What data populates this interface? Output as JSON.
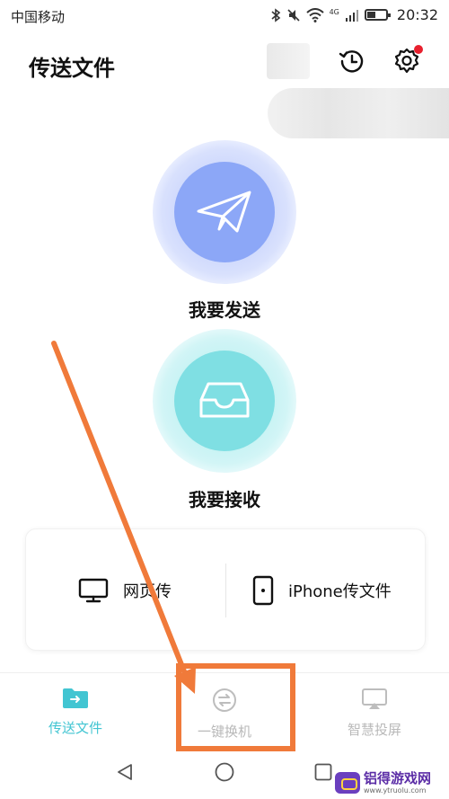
{
  "status_bar": {
    "carrier": "中国移动",
    "network": "4G",
    "time": "20:32",
    "icons": [
      "bluetooth-icon",
      "mute-icon",
      "wifi-icon",
      "signal-icon",
      "battery-icon"
    ]
  },
  "header": {
    "title": "传送文件",
    "history_icon": "history-icon",
    "settings_icon": "gear-icon",
    "settings_badge_color": "#e8202e"
  },
  "actions": {
    "send": {
      "label": "我要发送",
      "icon": "paper-plane-icon",
      "color": "#8ca7f7"
    },
    "receive": {
      "label": "我要接收",
      "icon": "inbox-tray-icon",
      "color": "#7fdfe3"
    }
  },
  "options": [
    {
      "label": "网页传",
      "icon": "monitor-icon"
    },
    {
      "label": "iPhone传文件",
      "icon": "phone-icon"
    }
  ],
  "bottom_nav": [
    {
      "label": "传送文件",
      "icon": "folder-transfer-icon",
      "active": true
    },
    {
      "label": "一键换机",
      "icon": "switch-phone-icon",
      "active": false
    },
    {
      "label": "智慧投屏",
      "icon": "screen-cast-icon",
      "active": false
    }
  ],
  "theme": {
    "accent": "#42c5d2",
    "inactive": "#b9b9b9",
    "annotation": "#f07a3a"
  },
  "watermark": {
    "title": "铝得游戏网",
    "url": "www.ytruolu.com"
  }
}
